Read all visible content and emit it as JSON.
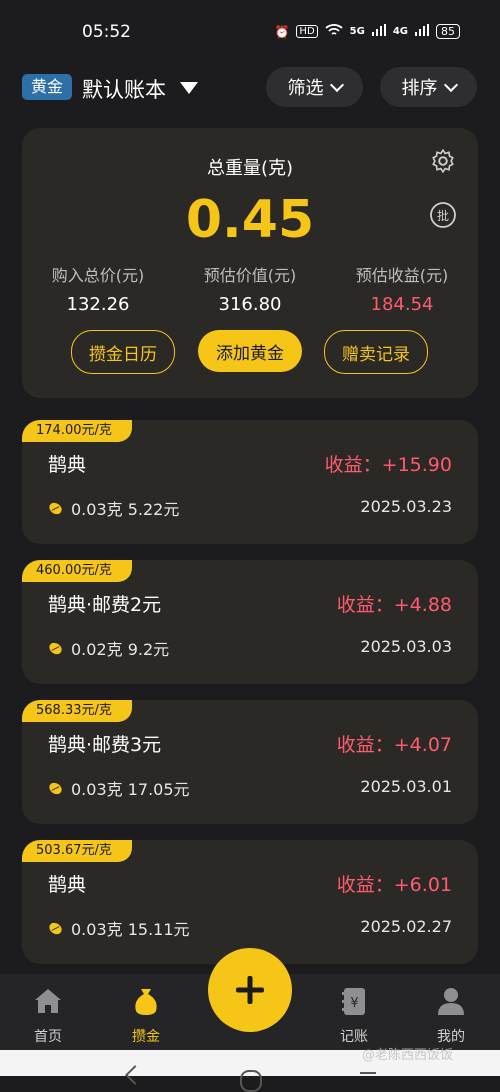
{
  "status": {
    "time": "05:52",
    "battery": "85",
    "net1": "5G",
    "net2": "4G"
  },
  "header": {
    "tag": "黄金",
    "account": "默认账本",
    "filter": "筛选",
    "sort": "排序"
  },
  "summary": {
    "title": "总重量(克)",
    "weight": "0.45",
    "purchase_label": "购入总价(元)",
    "purchase_value": "132.26",
    "estimate_label": "预估价值(元)",
    "estimate_value": "316.80",
    "profit_label": "预估收益(元)",
    "profit_value": "184.54",
    "btn_calendar": "攒金日历",
    "btn_add": "添加黄金",
    "btn_gift": "赠卖记录"
  },
  "records": [
    {
      "price": "174.00元/克",
      "name": "鹊典",
      "profit": "收益：+15.90",
      "detail": "0.03克 5.22元",
      "date": "2025.03.23"
    },
    {
      "price": "460.00元/克",
      "name": "鹊典·邮费2元",
      "profit": "收益：+4.88",
      "detail": "0.02克 9.2元",
      "date": "2025.03.03"
    },
    {
      "price": "568.33元/克",
      "name": "鹊典·邮费3元",
      "profit": "收益：+4.07",
      "detail": "0.03克 17.05元",
      "date": "2025.03.01"
    },
    {
      "price": "503.67元/克",
      "name": "鹊典",
      "profit": "收益：+6.01",
      "detail": "0.03克 15.11元",
      "date": "2025.02.27"
    }
  ],
  "nav": {
    "home": "首页",
    "save": "攒金",
    "ledger": "记账",
    "mine": "我的"
  },
  "watermark": "@老陈西西饭饭",
  "colors": {
    "accent": "#f5c518",
    "profit": "#ff5a6e",
    "background": "#1c1c1e",
    "card": "#2b2926"
  },
  "icons": [
    "alarm-icon",
    "hd-icon",
    "wifi-icon",
    "signal-icon",
    "battery-icon",
    "dropdown-icon",
    "chevron-down-icon",
    "gear-icon",
    "batch-icon",
    "bean-icon",
    "home-icon",
    "gold-bag-icon",
    "plus-icon",
    "ledger-icon",
    "user-icon"
  ]
}
